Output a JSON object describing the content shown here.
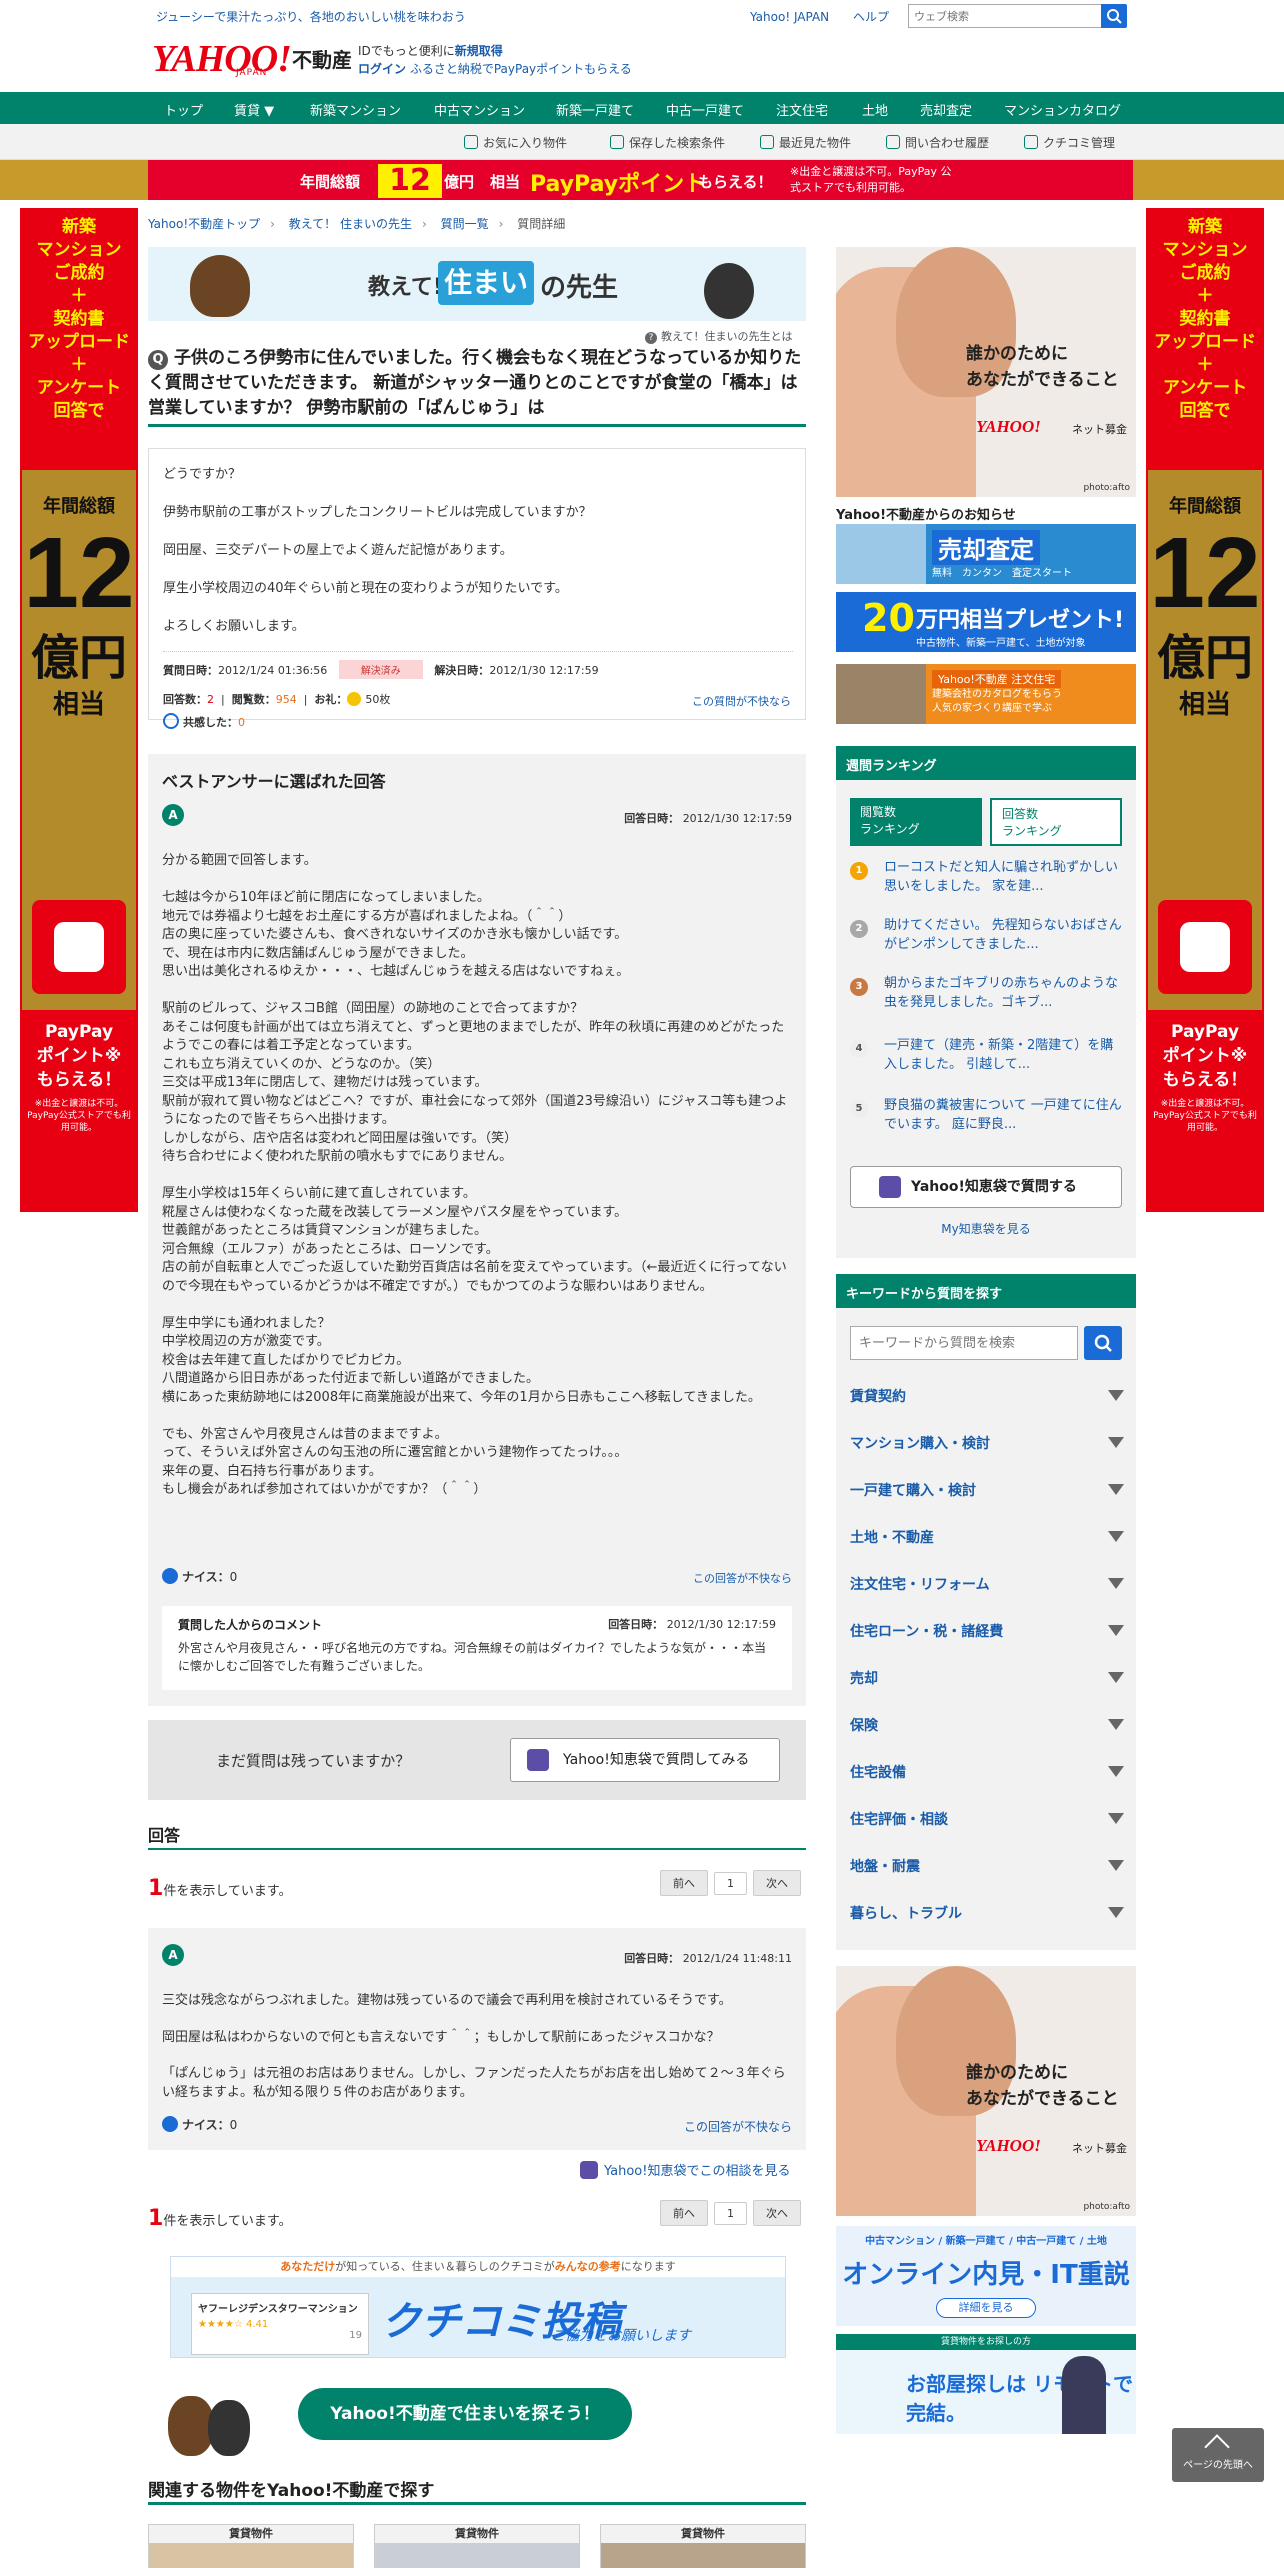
{
  "header": {
    "tagline": "ジューシーで果汁たっぷり、各地のおいしい桃を味わおう",
    "links": [
      "Yahoo! JAPAN",
      "ヘルプ"
    ],
    "search_placeholder": "ウェブ検索",
    "logo": "YAHOO!",
    "logo_sub": "JAPAN",
    "logo_service": "不動産",
    "id_promo_1": "IDでもっと便利に",
    "id_promo_new": "新規取得",
    "id_login": "ログイン",
    "id_promo_2": "ふるさと納税でPayPayポイントもらえる"
  },
  "nav": {
    "items": [
      "トップ",
      "賃貸 ▼",
      "新築マンション",
      "中古マンション",
      "新築一戸建て",
      "中古一戸建て",
      "注文住宅",
      "土地",
      "売却査定",
      "マンションカタログ"
    ]
  },
  "subnav": {
    "items": [
      "お気に入り物件",
      "保存した検索条件",
      "最近見た物件",
      "問い合わせ履歴",
      "クチコミ管理"
    ]
  },
  "campaign": {
    "label1": "年間総額",
    "num": "12",
    "label2": "億円",
    "label3": "相当",
    "paypay": "PayPayポイント",
    "label4": "もらえる！",
    "note": "※出金と譲渡は不可。PayPay 公式ストアでも利用可能。"
  },
  "side_ad": {
    "top": [
      "新築",
      "マンション",
      "ご成約",
      "＋",
      "契約書",
      "アップロード",
      "＋",
      "アンケート",
      "回答で"
    ],
    "annual": "年間総額",
    "num": "12",
    "unit": "億円",
    "equiv": "相当",
    "paypay": [
      "PayPay",
      "ポイント※",
      "もらえる！"
    ],
    "note": "※出金と譲渡は不可。PayPay公式ストアでも利用可能。"
  },
  "breadcrumb": [
    "Yahoo!不動産トップ",
    "教えて！ 住まいの先生",
    "質問一覧",
    "質問詳細"
  ],
  "sensei": {
    "t1": "教えて!",
    "t2": "住まい",
    "t3": "の先生",
    "about": "教えて！住まいの先生とは"
  },
  "question": {
    "title": "子供のころ伊勢市に住んでいました。行く機会もなく現在どうなっているか知りたく質問させていただきます。 新道がシャッター通りとのことですが食堂の「橋本」は営業していますか？ 伊勢市駅前の「ぱんじゅう」は",
    "body": [
      "どうですか？",
      "伊勢市駅前の工事がストップしたコンクリートビルは完成していますか？",
      "岡田屋、三交デパートの屋上でよく遊んだ記憶があります。",
      "厚生小学校周辺の40年ぐらい前と現在の変わりようが知りたいです。",
      "よろしくお願いします。"
    ],
    "date_label": "質問日時：",
    "date": "2012/1/24 01:36:56",
    "status": "解決済み",
    "solved_label": "解決日時：",
    "solved": "2012/1/30 12:17:59",
    "answers_label": "回答数：",
    "answers": "2",
    "views_label": "閲覧数：",
    "views": "954",
    "reward_label": "お礼：",
    "reward": "50枚",
    "empathy_label": "共感した：",
    "empathy": "0",
    "report": "この質問が不快なら"
  },
  "best_answer": {
    "heading": "ベストアンサーに選ばれた回答",
    "avatar": "A",
    "date_label": "回答日時：",
    "date": "2012/1/30 12:17:59",
    "paragraphs": [
      "分かる範囲で回答します。",
      "七越は今から10年ほど前に閉店になってしまいました。\n地元では券福より七越をお土産にする方が喜ばれましたよね。（＾＾）\n店の奥に座っていた婆さんも、食べきれないサイズのかき氷も懐かしい話です。\nで、現在は市内に数店舗ぱんじゅう屋ができました。\n思い出は美化されるゆえか・・・、七越ぱんじゅうを越える店はないですねぇ。",
      "駅前のビルって、ジャスコB館（岡田屋）の跡地のことで合ってますか？\nあそこは何度も計画が出ては立ち消えてと、ずっと更地のままでしたが、昨年の秋頃に再建のめどがたったようでこの春には着工予定となっています。\nこれも立ち消えていくのか、どうなのか。（笑）\n三交は平成13年に閉店して、建物だけは残っています。\n駅前が寂れて買い物などはどこへ？ですが、車社会になって郊外（国道23号線沿い）にジャスコ等も建つようになったので皆そちらへ出掛けます。\nしかしながら、店や店名は変われど岡田屋は強いです。（笑）\n待ち合わせによく使われた駅前の噴水もすでにありません。",
      "厚生小学校は15年くらい前に建て直しされています。\n糀屋さんは使わなくなった蔵を改装してラーメン屋やパスタ屋をやっています。\n世義館があったところは賃貸マンションが建ちました。\n河合無線（エルファ）があったところは、ローソンです。\n店の前が自転車と人でごった返していた勤労百貨店は名前を変えてやっています。（←最近近くに行ってないので今現在もやっているかどうかは不確定ですが。）でもかつてのような賑わいはありません。",
      "厚生中学にも通われました？\n中学校周辺の方が激変です。\n校舎は去年建て直したばかりでピカピカ。\n八間道路から旧日赤があった付近まで新しい道路ができました。\n横にあった東紡跡地には2008年に商業施設が出来て、今年の1月から日赤もここへ移転してきました。",
      "でも、外宮さんや月夜見さんは昔のままですよ。\nって、そういえば外宮さんの勾玉池の所に遷宮館とかいう建物作ってたっけ。。。\n来年の夏、白石持ち行事があります。\nもし機会があれば参加されてはいかがですか？（＾＾）"
    ],
    "nice_label": "ナイス：",
    "nice": "0",
    "report": "この回答が不快なら",
    "comment_heading": "質問した人からのコメント",
    "comment_date_label": "回答日時：",
    "comment_date": "2012/1/30 12:17:59",
    "comment_text": "外宮さんや月夜見さん・・呼び名地元の方ですね。河合無線その前はダイカイ？でしたような気が・・・本当に懐かしむご回答でした有難うございました。"
  },
  "still": {
    "text": "まだ質問は残っていますか？",
    "button": "Yahoo!知恵袋で質問してみる"
  },
  "answers": {
    "heading": "回答",
    "count": "1",
    "count_text": "件を表示しています。",
    "pager": [
      "前へ",
      "1",
      "次へ"
    ],
    "item": {
      "avatar": "A",
      "date_label": "回答日時：",
      "date": "2012/1/24 11:48:11",
      "paragraphs": [
        "三交は残念ながらつぶれました。建物は残っているので議会で再利用を検討されているそうです。",
        "岡田屋は私はわからないので何とも言えないです＾＾；もしかして駅前にあったジャスコかな？",
        "「ぱんじゅう」は元祖のお店はありません。しかし、ファンだった人たちがお店を出し始めて２～３年ぐらい経ちますよ。私が知る限り５件のお店があります。"
      ],
      "nice_label": "ナイス：",
      "nice": "0",
      "report": "この回答が不快なら"
    },
    "chie_link": "Yahoo!知恵袋でこの相談を見る"
  },
  "kuchikomi": {
    "top_a": "あなただけ",
    "top_b": "が知っている、住まい＆暮らしのクチコミが",
    "top_c": "みんなの参考",
    "top_d": "になります",
    "card_title": "ヤフーレジデンスタワーマンション",
    "card_rating": "4.41",
    "card_count": "19",
    "big": "クチコミ投稿",
    "small": "ご協力をお願いします"
  },
  "find_button": "Yahoo!不動産で住まいを探そう！",
  "related": {
    "heading": "関連する物件をYahoo!不動産で探す",
    "cards": [
      "賃貸物件",
      "賃貸物件",
      "賃貸物件"
    ]
  },
  "right": {
    "charity_text": "誰かのために\nあなたができること",
    "charity_logo": "YAHOO!",
    "charity_logo_sub": "ネット募金",
    "charity_photo": "photo:afto",
    "notice_heading": "Yahoo!不動産からのお知らせ",
    "nb1_big": "売却査定",
    "nb1_small": "無料　カンタン　査定スタート",
    "nb2_big": "20",
    "nb2_text": "万円相当プレゼント!",
    "nb2_small": "中古物件、新築一戸建て、土地が対象",
    "nb3_badge": "Yahoo!不動産 注文住宅",
    "nb3_text": "建築会社のカタログをもらう\n人気の家づくり講座で学ぶ",
    "ranking_heading": "週間ランキング",
    "rank_tabs": [
      "閲覧数\nランキング",
      "回答数\nランキング"
    ],
    "ranking": [
      {
        "n": "1",
        "t": "ローコストだと知人に騙され恥ずかしい思いをしました。 家を建..."
      },
      {
        "n": "2",
        "t": "助けてください。 先程知らないおばさんがピンポンしてきました..."
      },
      {
        "n": "3",
        "t": "朝からまたゴキブリの赤ちゃんのような虫を発見しました。ゴキブ..."
      },
      {
        "n": "4",
        "t": "一戸建て（建売・新築・2階建て）を購入しました。 引越して..."
      },
      {
        "n": "5",
        "t": "野良猫の糞被害について 一戸建てに住んでいます。 庭に野良..."
      }
    ],
    "chie_button": "Yahoo!知恵袋で質問する",
    "my_chie": "My知恵袋を見る",
    "kw_heading": "キーワードから質問を探す",
    "kw_placeholder": "キーワードから質問を検索",
    "categories": [
      "賃貸契約",
      "マンション購入・検討",
      "一戸建て購入・検討",
      "土地・不動産",
      "注文住宅・リフォーム",
      "住宅ローン・税・諸経費",
      "売却",
      "保険",
      "住宅設備",
      "住宅評価・相談",
      "地盤・耐震",
      "暮らし、トラブル"
    ],
    "ad1_top": "中古マンション / 新築一戸建て / 中古一戸建て / 土地",
    "ad1_big": "オンライン内見・IT重説",
    "ad1_btn": "詳細を見る",
    "ad2_top": "賃貸物件をお探しの方",
    "ad2_big": "お部屋探しは リモートで完結。"
  },
  "totop": "ページの先頭へ",
  "colors": {
    "green": "#00826b",
    "red": "#e60012",
    "link": "#1a5ca8"
  }
}
